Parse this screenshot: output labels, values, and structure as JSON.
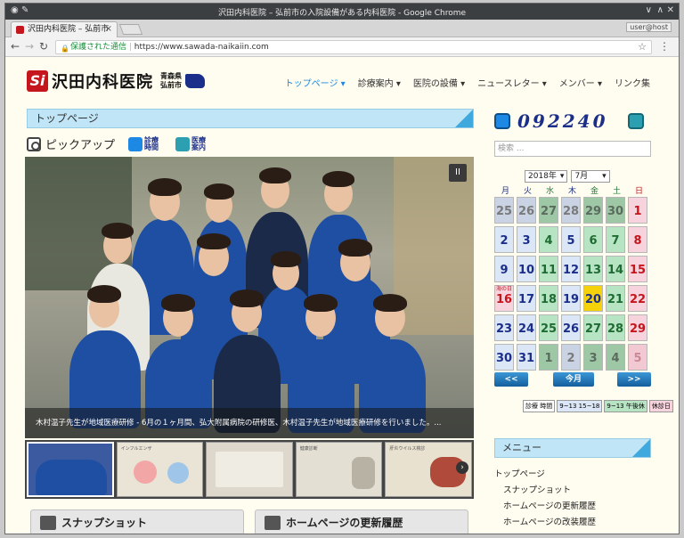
{
  "browser": {
    "window_title": "沢田内科医院 – 弘前市の入院設備がある内科医院 - Google Chrome",
    "tab_title": "沢田内科医院 – 弘前市",
    "user_label": "user@host",
    "secure_label": "保護された通信",
    "url": "https://www.sawada-naikaiin.com"
  },
  "site": {
    "logo_mark": "Si",
    "logo_text": "沢田内科医院",
    "logo_sub": "青森県 弘前市",
    "nav": [
      {
        "label": "トップページ ▾"
      },
      {
        "label": "診療案内 ▾"
      },
      {
        "label": "医院の設備 ▾"
      },
      {
        "label": "ニュースレター ▾"
      },
      {
        "label": "メンバー ▾"
      },
      {
        "label": "リンク集"
      }
    ],
    "section_title": "トップページ",
    "pickup_label": "ピックアップ",
    "mini_links": [
      {
        "label": "診療時間",
        "color": "#1e88e5"
      },
      {
        "label": "医療案内",
        "color": "#2c9fb0"
      }
    ],
    "slide_caption": "木村温子先生が地域医療研修 - 6月の１ヶ月間、弘大附属病院の研修医、木村温子先生が地域医療研修を行いました。...",
    "pause_symbol": "II",
    "thumb_titles": [
      "",
      "インフルエンザ",
      "",
      "健康診断",
      "肝炎ウイルス検診"
    ],
    "panels": [
      {
        "label": "スナップショット"
      },
      {
        "label": "ホームページの更新履歴"
      }
    ]
  },
  "sidebar": {
    "visitor_count": "092240",
    "search_placeholder": "検索 ...",
    "calendar": {
      "year": "2018年",
      "month": "7月",
      "dow": [
        "月",
        "火",
        "水",
        "木",
        "金",
        "土",
        "日"
      ],
      "dow_colors": [
        "#1b2f8a",
        "#1b2f8a",
        "#1e7a3a",
        "#1b2f8a",
        "#1e7a3a",
        "#1e7a3a",
        "#c4161c"
      ],
      "days": [
        {
          "d": "25",
          "bg": "#c9d3e3",
          "fg": "#7a7a7a"
        },
        {
          "d": "26",
          "bg": "#c9d3e3",
          "fg": "#7a7a7a"
        },
        {
          "d": "27",
          "bg": "#9ec7a6",
          "fg": "#5b6b5e"
        },
        {
          "d": "28",
          "bg": "#c9d3e3",
          "fg": "#7a7a7a"
        },
        {
          "d": "29",
          "bg": "#9ec7a6",
          "fg": "#5b6b5e"
        },
        {
          "d": "30",
          "bg": "#9ec7a6",
          "fg": "#5b6b5e"
        },
        {
          "d": "1",
          "bg": "#f7d3de",
          "fg": "#c4161c"
        },
        {
          "d": "2",
          "bg": "#dbe6f6",
          "fg": "#1b2f8a"
        },
        {
          "d": "3",
          "bg": "#dbe6f6",
          "fg": "#1b2f8a"
        },
        {
          "d": "4",
          "bg": "#b7e4c2",
          "fg": "#1e6b33"
        },
        {
          "d": "5",
          "bg": "#dbe6f6",
          "fg": "#1b2f8a"
        },
        {
          "d": "6",
          "bg": "#b7e4c2",
          "fg": "#1e6b33"
        },
        {
          "d": "7",
          "bg": "#b7e4c2",
          "fg": "#1e6b33"
        },
        {
          "d": "8",
          "bg": "#f7d3de",
          "fg": "#c4161c"
        },
        {
          "d": "9",
          "bg": "#dbe6f6",
          "fg": "#1b2f8a"
        },
        {
          "d": "10",
          "bg": "#dbe6f6",
          "fg": "#1b2f8a"
        },
        {
          "d": "11",
          "bg": "#b7e4c2",
          "fg": "#1e6b33"
        },
        {
          "d": "12",
          "bg": "#dbe6f6",
          "fg": "#1b2f8a"
        },
        {
          "d": "13",
          "bg": "#b7e4c2",
          "fg": "#1e6b33"
        },
        {
          "d": "14",
          "bg": "#b7e4c2",
          "fg": "#1e6b33"
        },
        {
          "d": "15",
          "bg": "#f7d3de",
          "fg": "#c4161c"
        },
        {
          "d": "16",
          "bg": "#f7d3de",
          "fg": "#c4161c",
          "tag": "海の日"
        },
        {
          "d": "17",
          "bg": "#dbe6f6",
          "fg": "#1b2f8a"
        },
        {
          "d": "18",
          "bg": "#b7e4c2",
          "fg": "#1e6b33"
        },
        {
          "d": "19",
          "bg": "#dbe6f6",
          "fg": "#1b2f8a"
        },
        {
          "d": "20",
          "bg": "#f5d20a",
          "fg": "#1b2f8a"
        },
        {
          "d": "21",
          "bg": "#b7e4c2",
          "fg": "#1e6b33"
        },
        {
          "d": "22",
          "bg": "#f7d3de",
          "fg": "#c4161c"
        },
        {
          "d": "23",
          "bg": "#dbe6f6",
          "fg": "#1b2f8a"
        },
        {
          "d": "24",
          "bg": "#dbe6f6",
          "fg": "#1b2f8a"
        },
        {
          "d": "25",
          "bg": "#b7e4c2",
          "fg": "#1e6b33"
        },
        {
          "d": "26",
          "bg": "#dbe6f6",
          "fg": "#1b2f8a"
        },
        {
          "d": "27",
          "bg": "#b7e4c2",
          "fg": "#1e6b33"
        },
        {
          "d": "28",
          "bg": "#b7e4c2",
          "fg": "#1e6b33"
        },
        {
          "d": "29",
          "bg": "#f7d3de",
          "fg": "#c4161c"
        },
        {
          "d": "30",
          "bg": "#dbe6f6",
          "fg": "#1b2f8a"
        },
        {
          "d": "31",
          "bg": "#dbe6f6",
          "fg": "#1b2f8a"
        },
        {
          "d": "1",
          "bg": "#9ec7a6",
          "fg": "#5b6b5e"
        },
        {
          "d": "2",
          "bg": "#c9d3e3",
          "fg": "#7a7a7a"
        },
        {
          "d": "3",
          "bg": "#9ec7a6",
          "fg": "#5b6b5e"
        },
        {
          "d": "4",
          "bg": "#9ec7a6",
          "fg": "#5b6b5e"
        },
        {
          "d": "5",
          "bg": "#f2c8d3",
          "fg": "#c98a95"
        }
      ],
      "prev_label": "<<",
      "today_label": "今月",
      "next_label": ">>"
    },
    "legend": [
      {
        "label": "診療 時間",
        "bg": "#ffffff"
      },
      {
        "label": "9~13 15~18",
        "bg": "#dbe6f6"
      },
      {
        "label": "9~13 午後休",
        "bg": "#b7e4c2"
      },
      {
        "label": "休診日",
        "bg": "#f7d3de"
      }
    ],
    "menu_title": "メニュー",
    "menu_items": [
      {
        "label": "トップページ",
        "sub": false
      },
      {
        "label": "スナップショット",
        "sub": true
      },
      {
        "label": "ホームページの更新履歴",
        "sub": true
      },
      {
        "label": "ホームページの改装履歴",
        "sub": true
      }
    ]
  }
}
